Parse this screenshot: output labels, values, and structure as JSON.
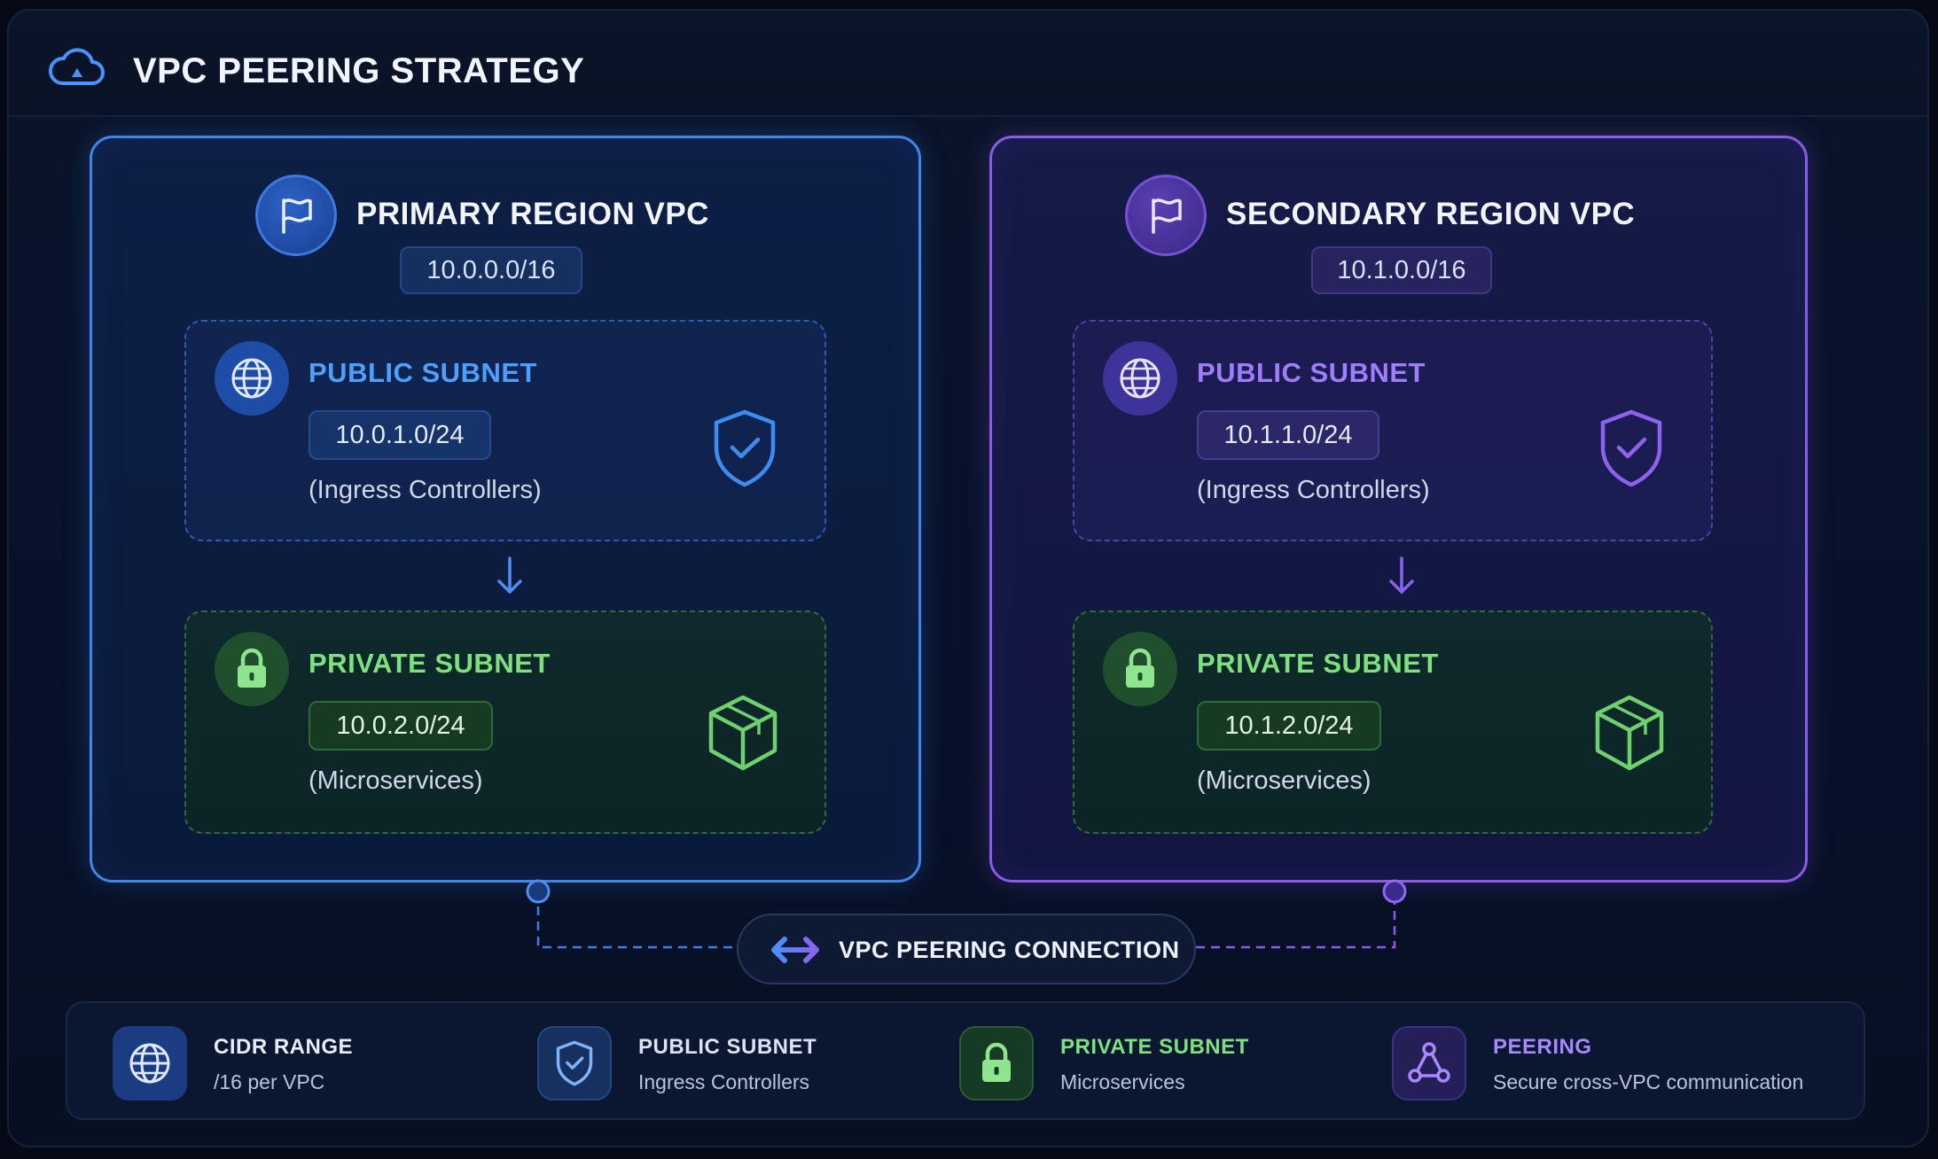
{
  "header": {
    "title": "VPC PEERING STRATEGY",
    "icon": "cloud-icon"
  },
  "primary": {
    "title": "PRIMARY REGION VPC",
    "cidr": "10.0.0.0/16",
    "public": {
      "title": "PUBLIC SUBNET",
      "cidr": "10.0.1.0/24",
      "desc": "(Ingress Controllers)"
    },
    "private": {
      "title": "PRIVATE SUBNET",
      "cidr": "10.0.2.0/24",
      "desc": "(Microservices)"
    }
  },
  "secondary": {
    "title": "SECONDARY REGION VPC",
    "cidr": "10.1.0.0/16",
    "public": {
      "title": "PUBLIC SUBNET",
      "cidr": "10.1.1.0/24",
      "desc": "(Ingress Controllers)"
    },
    "private": {
      "title": "PRIVATE SUBNET",
      "cidr": "10.1.2.0/24",
      "desc": "(Microservices)"
    }
  },
  "connection": {
    "label": "VPC PEERING CONNECTION"
  },
  "legend": [
    {
      "title": "CIDR RANGE",
      "sub": "/16 per VPC",
      "icon": "globe-icon"
    },
    {
      "title": "PUBLIC SUBNET",
      "sub": "Ingress Controllers",
      "icon": "shield-icon"
    },
    {
      "title": "PRIVATE SUBNET",
      "sub": "Microservices",
      "icon": "lock-icon"
    },
    {
      "title": "PEERING",
      "sub": "Secure cross-VPC communication",
      "icon": "network-icon"
    }
  ],
  "colors": {
    "primary_accent": "#3f86e8",
    "secondary_accent": "#8a5be8",
    "private_accent": "#7ee07e",
    "background": "#050a16"
  }
}
